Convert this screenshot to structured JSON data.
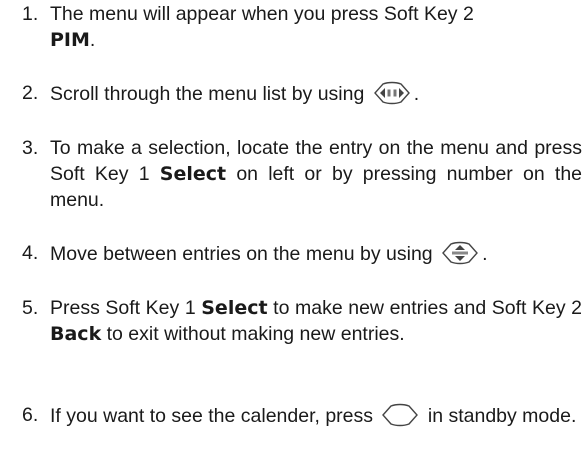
{
  "steps": [
    {
      "number": "1.",
      "text_before": "The menu will appear when you press Soft Key 2",
      "bold": "PIM",
      "text_after": "."
    },
    {
      "number": "2.",
      "text_before": "Scroll through the menu list by using",
      "icon": "left-right-navigation-key-icon",
      "text_after": "."
    },
    {
      "number": "3.",
      "text_before": "To make a selection, locate the entry on the menu and press Soft Key 1",
      "bold": "Select",
      "text_after": "on left or by pressing number on the menu."
    },
    {
      "number": "4.",
      "text_before": "Move between entries on the menu by using",
      "icon": "up-down-navigation-key-icon",
      "text_after": "."
    },
    {
      "number": "5.",
      "text_before": "Press Soft Key 1",
      "bold1": "Select",
      "text_middle": "to make new entries and Soft Key 2",
      "bold2": "Back",
      "text_after": "to exit without making new entries."
    },
    {
      "number": "6.",
      "text_before": "If you want to see the calender, press",
      "icon": "down-navigation-key-icon",
      "text_after": "in standby mode."
    }
  ]
}
